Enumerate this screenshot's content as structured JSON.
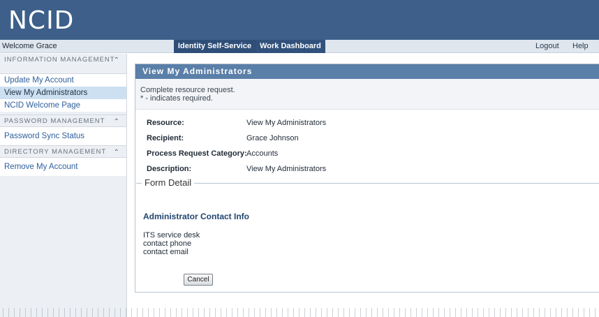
{
  "header": {
    "logo_text": "NCID"
  },
  "navbar": {
    "welcome": "Welcome Grace",
    "tabs": [
      {
        "label": "Identity Self-Service",
        "active": true
      },
      {
        "label": "Work Dashboard",
        "active": false
      }
    ],
    "logout": "Logout",
    "help": "Help"
  },
  "sidebar": {
    "sections": [
      {
        "title": "INFORMATION MANAGEMENT",
        "items": [
          {
            "label": "Update My Account",
            "active": false
          },
          {
            "label": "View My Administrators",
            "active": true
          },
          {
            "label": "NCID Welcome Page",
            "active": false
          }
        ]
      },
      {
        "title": "PASSWORD MANAGEMENT",
        "items": [
          {
            "label": "Password Sync Status",
            "active": false
          }
        ]
      },
      {
        "title": "DIRECTORY MANAGEMENT",
        "items": [
          {
            "label": "Remove My Account",
            "active": false
          }
        ]
      }
    ],
    "collapse_icon": "double-chevron-up-icon"
  },
  "main": {
    "title": "View My Administrators",
    "intro_line1": "Complete resource request.",
    "intro_line2": "* - indicates required.",
    "fields": [
      {
        "label": "Resource:",
        "value": "View My Administrators"
      },
      {
        "label": "Recipient:",
        "value": "Grace Johnson"
      },
      {
        "label": "Process Request Category:",
        "value": "Accounts"
      },
      {
        "label": "Description:",
        "value": "View My Administrators"
      }
    ],
    "form_detail": {
      "legend": "Form Detail",
      "contact_title": "Administrator Contact Info",
      "contact_lines": [
        "ITS service desk",
        "contact phone",
        "contact email"
      ],
      "cancel_label": "Cancel"
    }
  },
  "colors": {
    "header_bg": "#3d5f8a",
    "active_tab_bg": "#2e4e78",
    "panel_title_bg": "#5a7fa8",
    "link": "#2e5f9c",
    "active_item_bg": "#cde0f2"
  }
}
